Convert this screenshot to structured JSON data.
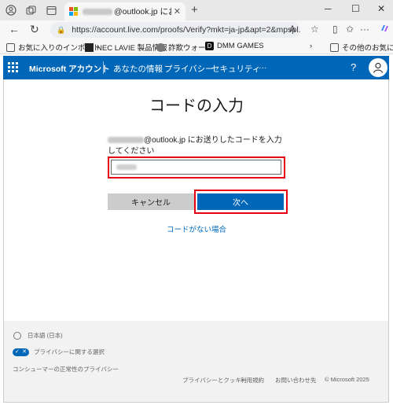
{
  "browser": {
    "tab_title": "@outlook.jp にお送りしたコ",
    "address": "https://account.live.com/proofs/Verify?mkt=ja-jp&apt=2&mpspl...",
    "bookmarks": [
      "お気に入りのインポート",
      "NEC LAVIE 製品情報",
      "詐欺ウォール",
      "DMM GAMES"
    ],
    "other_favorites": "その他のお気に入り"
  },
  "msnav": {
    "brand": "Microsoft アカウント",
    "items": [
      "あなたの情報",
      "プライバシー",
      "セキュリティ",
      "···"
    ],
    "help": "?"
  },
  "main": {
    "heading": "コードの入力",
    "desc_suffix": "@outlook.jp にお送りしたコードを入力してください",
    "cancel_label": "キャンセル",
    "next_label": "次へ",
    "nocode_link": "コードがない場合"
  },
  "footer": {
    "language": "日本語 (日本)",
    "privacy_choices": "プライバシーに関する選択",
    "consumer_privacy": "コンシューマーの正常性のプライバシー",
    "links": [
      "プライバシーとクッキー",
      "利用規約",
      "お問い合わせ先",
      "© Microsoft 2025"
    ]
  },
  "colors": {
    "accent": "#0067b8",
    "highlight": "#e60012"
  }
}
